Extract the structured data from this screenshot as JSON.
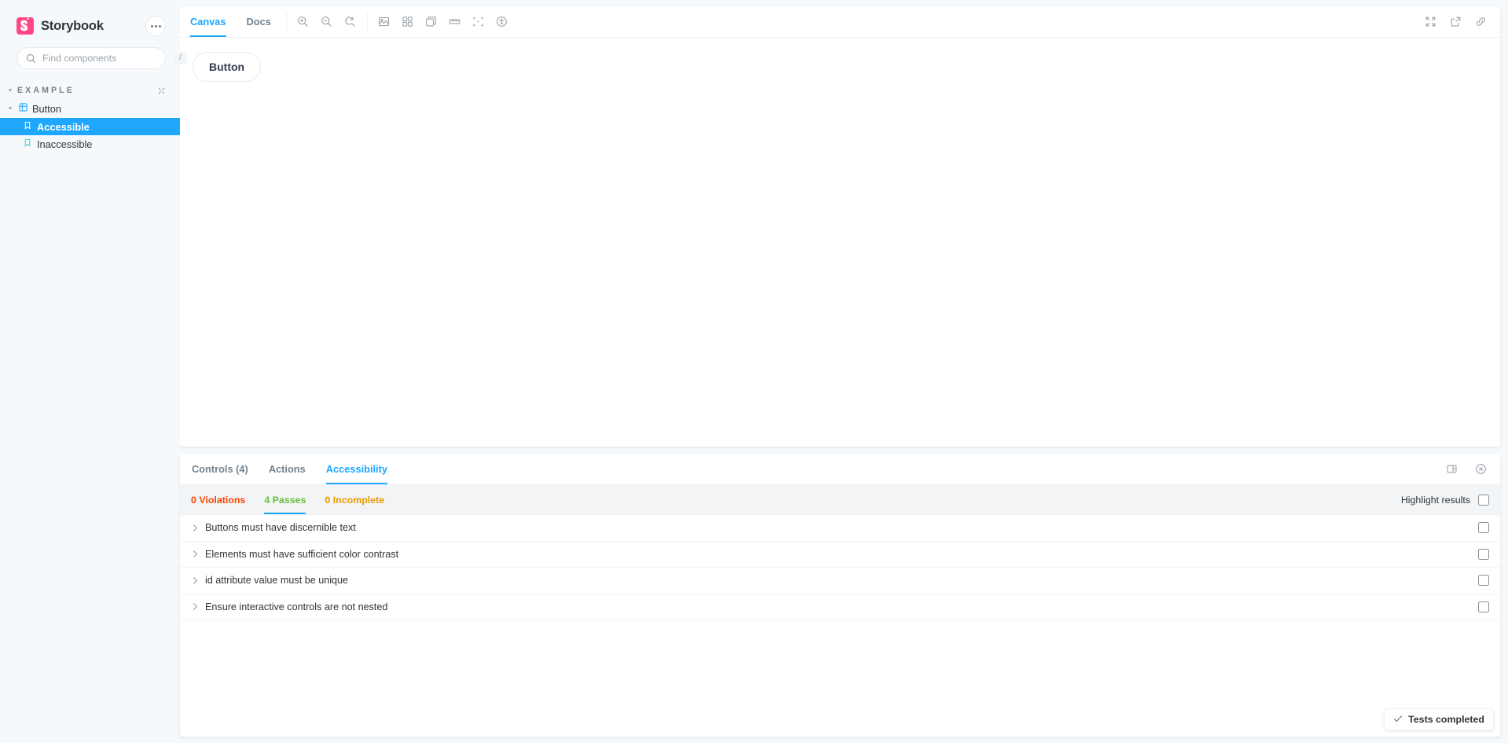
{
  "sidebar": {
    "brand": {
      "name": "Storybook",
      "logo_icon": "storybook-logo-icon",
      "brand_color": "#FF4785"
    },
    "menu_button_name": "sidebar-menu-button",
    "search": {
      "placeholder": "Find components",
      "value": "",
      "shortcut": "/",
      "icon": "search-icon"
    },
    "tree": {
      "root_label": "EXAMPLE",
      "collapse_all_title": "Collapse all",
      "component": {
        "label": "Button",
        "icon": "component-icon",
        "expanded": true
      },
      "stories": [
        {
          "label": "Accessible",
          "icon": "story-bookmark-icon",
          "selected": true
        },
        {
          "label": "Inaccessible",
          "icon": "story-bookmark-icon",
          "selected": false
        }
      ]
    }
  },
  "toolbar": {
    "tabs": [
      {
        "label": "Canvas",
        "active": true
      },
      {
        "label": "Docs",
        "active": false
      }
    ],
    "zoom_controls": [
      {
        "name": "zoom-in-icon",
        "title": "Zoom in"
      },
      {
        "name": "zoom-out-icon",
        "title": "Zoom out"
      },
      {
        "name": "zoom-reset-icon",
        "title": "Reset zoom"
      }
    ],
    "view_controls": [
      {
        "name": "background-image-icon",
        "title": "Change background"
      },
      {
        "name": "grid-icon",
        "title": "Apply a grid to the preview"
      },
      {
        "name": "viewport-icon",
        "title": "Change the size of the preview"
      },
      {
        "name": "measure-icon",
        "title": "Measure"
      },
      {
        "name": "outline-icon",
        "title": "Apply outlines to the preview"
      },
      {
        "name": "accessibility-icon",
        "title": "Vision simulator"
      }
    ],
    "right_controls": [
      {
        "name": "fullscreen-icon",
        "title": "Go full screen"
      },
      {
        "name": "open-new-tab-icon",
        "title": "Open canvas in new tab"
      },
      {
        "name": "copy-link-icon",
        "title": "Copy canvas link"
      }
    ]
  },
  "preview": {
    "story_button_label": "Button"
  },
  "addon_panel": {
    "tabs": [
      {
        "label": "Controls (4)",
        "active": false
      },
      {
        "label": "Actions",
        "active": false
      },
      {
        "label": "Accessibility",
        "active": true
      }
    ],
    "panel_controls": [
      {
        "name": "panel-position-icon",
        "title": "Change addon orientation"
      },
      {
        "name": "close-panel-icon",
        "title": "Hide addons"
      }
    ],
    "accessibility": {
      "subtabs": [
        {
          "label": "0 Violations",
          "color": "#FF4400",
          "active": false
        },
        {
          "label": "4 Passes",
          "color": "#66BF3C",
          "active": true
        },
        {
          "label": "0 Incomplete",
          "color": "#E69D00",
          "active": false
        }
      ],
      "highlight": {
        "label": "Highlight results",
        "checked": false
      },
      "rules": [
        {
          "label": "Buttons must have discernible text",
          "checked": false
        },
        {
          "label": "Elements must have sufficient color contrast",
          "checked": false
        },
        {
          "label": "id attribute value must be unique",
          "checked": false
        },
        {
          "label": "Ensure interactive controls are not nested",
          "checked": false
        }
      ],
      "status_badge": {
        "label": "Tests completed",
        "icon": "check-icon"
      }
    }
  },
  "theme": {
    "accent": "#1EA7FD",
    "app_bg": "#f6f9fc",
    "text": "#2E3438",
    "muted_text": "#73828C"
  }
}
